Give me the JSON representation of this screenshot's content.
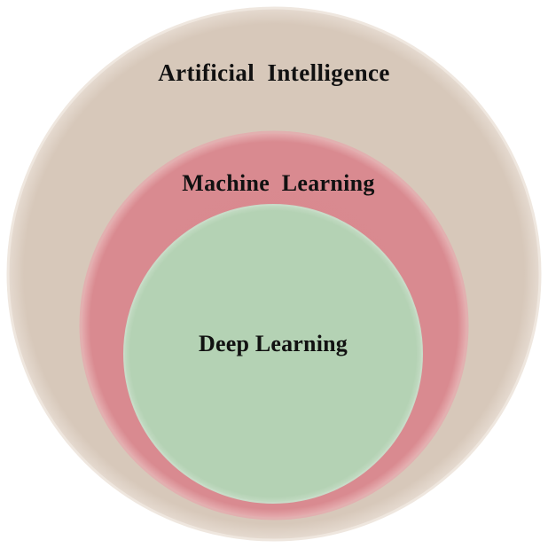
{
  "diagram": {
    "circles": [
      {
        "id": "artificial-intelligence",
        "label": "Artificial  Intelligence",
        "fill": "#d7c8ba"
      },
      {
        "id": "machine-learning",
        "label": "Machine  Learning",
        "fill": "#d9888e"
      },
      {
        "id": "deep-learning",
        "label": "Deep Learning",
        "fill": "#b4d2b4"
      }
    ],
    "colors": {
      "outer_edge": "#efe7df",
      "ring_edge": "#e8a6aa",
      "text": "#111111",
      "background": "#ffffff"
    }
  }
}
